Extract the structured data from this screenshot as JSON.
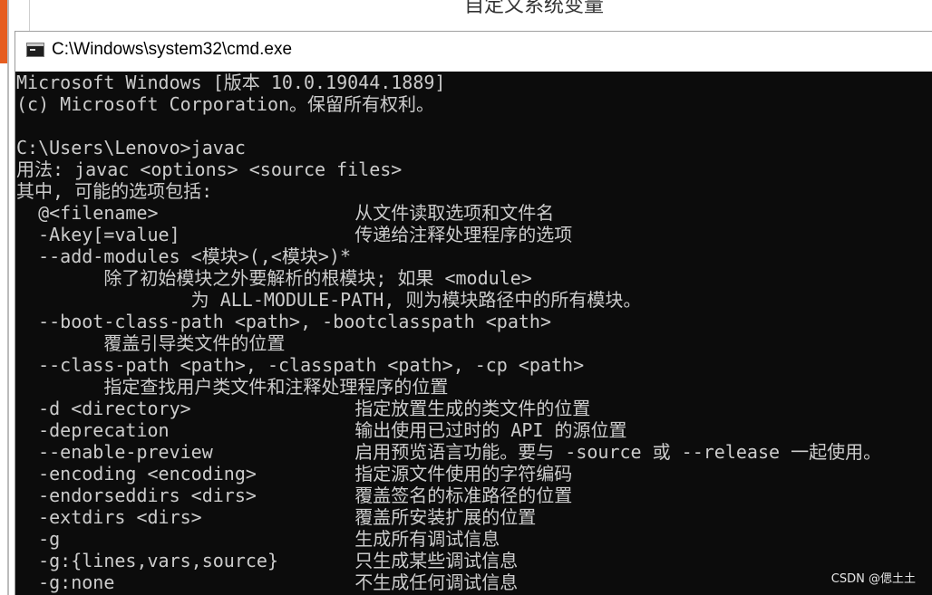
{
  "background_window": {
    "title_fragment": "自定义系统变量"
  },
  "window": {
    "title": "C:\\Windows\\system32\\cmd.exe",
    "icon": "cmd-icon"
  },
  "console": {
    "lines": [
      "Microsoft Windows [版本 10.0.19044.1889]",
      "(c) Microsoft Corporation。保留所有权利。",
      "",
      "C:\\Users\\Lenovo>javac",
      "用法: javac <options> <source files>",
      "其中, 可能的选项包括:",
      "  @<filename>                  从文件读取选项和文件名",
      "  -Akey[=value]                传递给注释处理程序的选项",
      "  --add-modules <模块>(,<模块>)*",
      "        除了初始模块之外要解析的根模块; 如果 <module>",
      "                为 ALL-MODULE-PATH, 则为模块路径中的所有模块。",
      "  --boot-class-path <path>, -bootclasspath <path>",
      "        覆盖引导类文件的位置",
      "  --class-path <path>, -classpath <path>, -cp <path>",
      "        指定查找用户类文件和注释处理程序的位置",
      "  -d <directory>               指定放置生成的类文件的位置",
      "  -deprecation                 输出使用已过时的 API 的源位置",
      "  --enable-preview             启用预览语言功能。要与 -source 或 --release 一起使用。",
      "  -encoding <encoding>         指定源文件使用的字符编码",
      "  -endorseddirs <dirs>         覆盖签名的标准路径的位置",
      "  -extdirs <dirs>              覆盖所安装扩展的位置",
      "  -g                           生成所有调试信息",
      "  -g:{lines,vars,source}       只生成某些调试信息",
      "  -g:none                      不生成任何调试信息"
    ]
  },
  "watermark": "CSDN @偲土土",
  "colors": {
    "console_bg": "#0c0c0c",
    "console_fg": "#cccccc",
    "titlebar_bg": "#ffffff"
  }
}
